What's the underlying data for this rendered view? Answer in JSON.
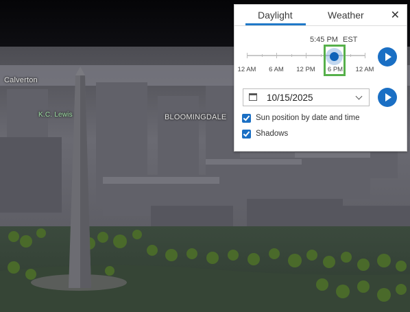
{
  "map": {
    "labels": {
      "calverton": "Calverton",
      "kc_lewis": "K.C. Lewis",
      "bloomingdale": "BLOOMINGDALE"
    }
  },
  "daylight_panel": {
    "tabs": [
      {
        "label": "Daylight",
        "active": true
      },
      {
        "label": "Weather",
        "active": false
      }
    ],
    "close_icon": "close-icon",
    "time": "5:45 PM",
    "timezone": "EST",
    "slider": {
      "labels": [
        "12 AM",
        "6 AM",
        "12 PM",
        "6 PM",
        "12 AM"
      ],
      "value_fraction": 0.74
    },
    "date": "10/15/2025",
    "calendar_icon": "calendar-icon",
    "dropdown_icon": "chevron-down-icon",
    "play_icon": "play-icon",
    "sun_position_label": "Sun position by date and time",
    "sun_position_checked": true,
    "shadows_label": "Shadows",
    "shadows_checked": true
  },
  "colors": {
    "accent": "#1a6fc4",
    "highlight": "#56b04a"
  }
}
